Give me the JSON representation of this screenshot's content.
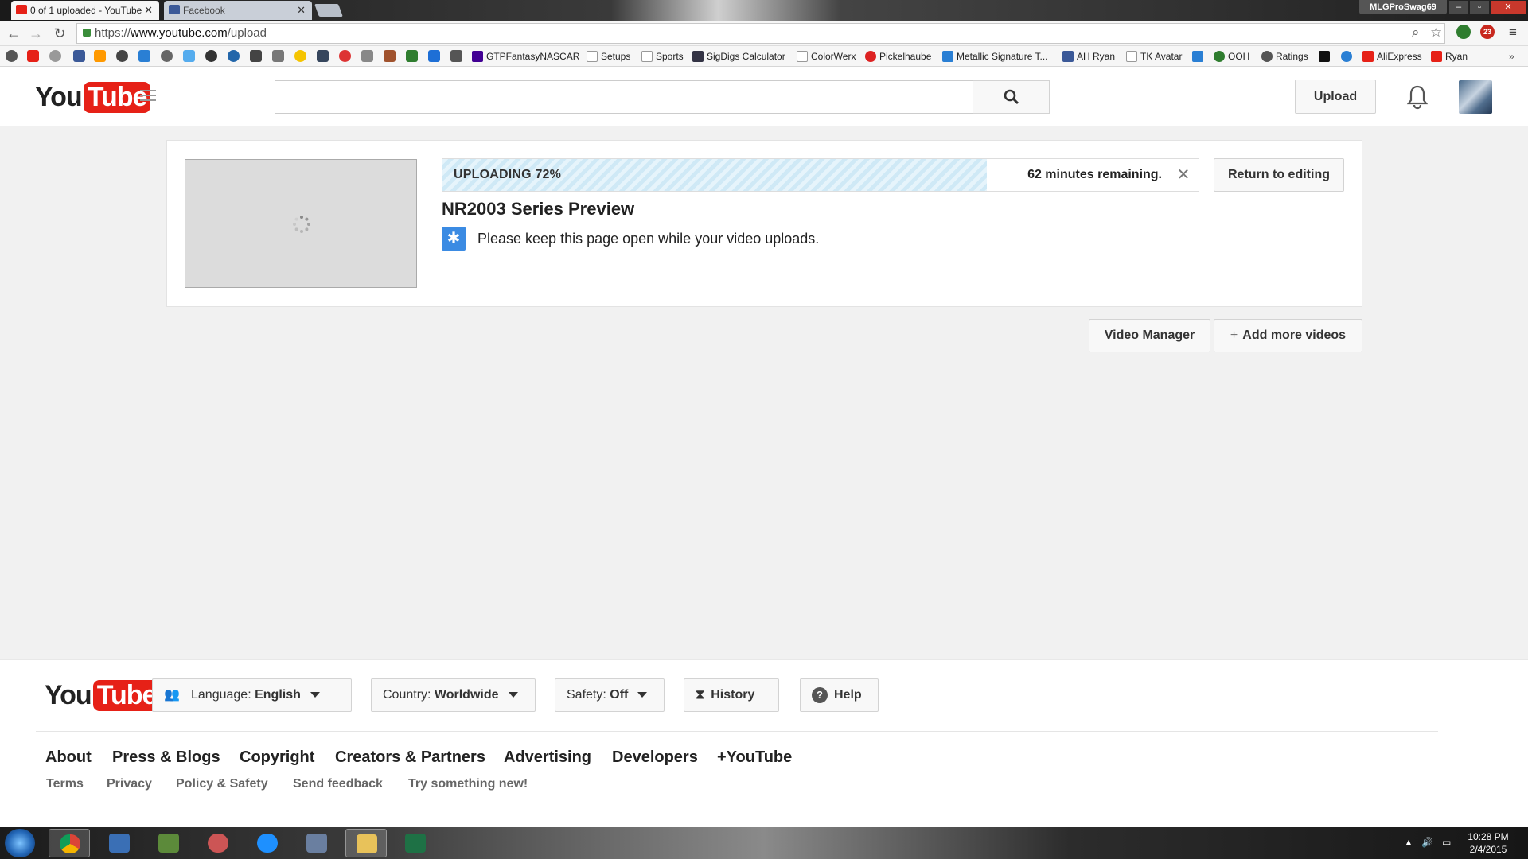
{
  "browser": {
    "tabs": [
      {
        "label": "0 of 1 uploaded - YouTube",
        "active": true
      },
      {
        "label": "Facebook",
        "active": false
      }
    ],
    "profile_name": "MLGProSwag69",
    "url_scheme": "https://",
    "url_host": "www.youtube.com",
    "url_path": "/upload",
    "abp_count": "23"
  },
  "bookmarks": [
    "GTPFantasyNASCAR",
    "Setups",
    "Sports",
    "SigDigs Calculator",
    "ColorWerx",
    "Pickelhaube",
    "Metallic Signature T...",
    "AH Ryan",
    "TK Avatar",
    "OOH",
    "Ratings",
    "AliExpress",
    "Ryan"
  ],
  "youtube": {
    "logo_you": "You",
    "logo_tube": "Tube",
    "search_placeholder": "",
    "upload_label": "Upload"
  },
  "upload": {
    "status": "UPLOADING 72%",
    "progress_percent": 72,
    "remaining": "62 minutes remaining.",
    "cancel_glyph": "✕",
    "return_label": "Return to editing",
    "video_title": "NR2003 Series Preview",
    "notice": "Please keep this page open while your video uploads."
  },
  "actions": {
    "video_manager": "Video Manager",
    "add_more": "Add more videos"
  },
  "footer": {
    "language_label": "Language:",
    "language_value": "English",
    "country_label": "Country:",
    "country_value": "Worldwide",
    "safety_label": "Safety:",
    "safety_value": "Off",
    "history": "History",
    "help": "Help",
    "links_primary": [
      "About",
      "Press & Blogs",
      "Copyright",
      "Creators & Partners",
      "Advertising",
      "Developers",
      "+YouTube"
    ],
    "links_secondary": [
      "Terms",
      "Privacy",
      "Policy & Safety",
      "Send feedback",
      "Try something new!"
    ]
  },
  "taskbar": {
    "time": "10:28 PM",
    "date": "2/4/2015"
  },
  "colors": {
    "youtube_red": "#e62117",
    "progress_stripe": "#cfe9f6",
    "notice_blue": "#3b8be3"
  }
}
